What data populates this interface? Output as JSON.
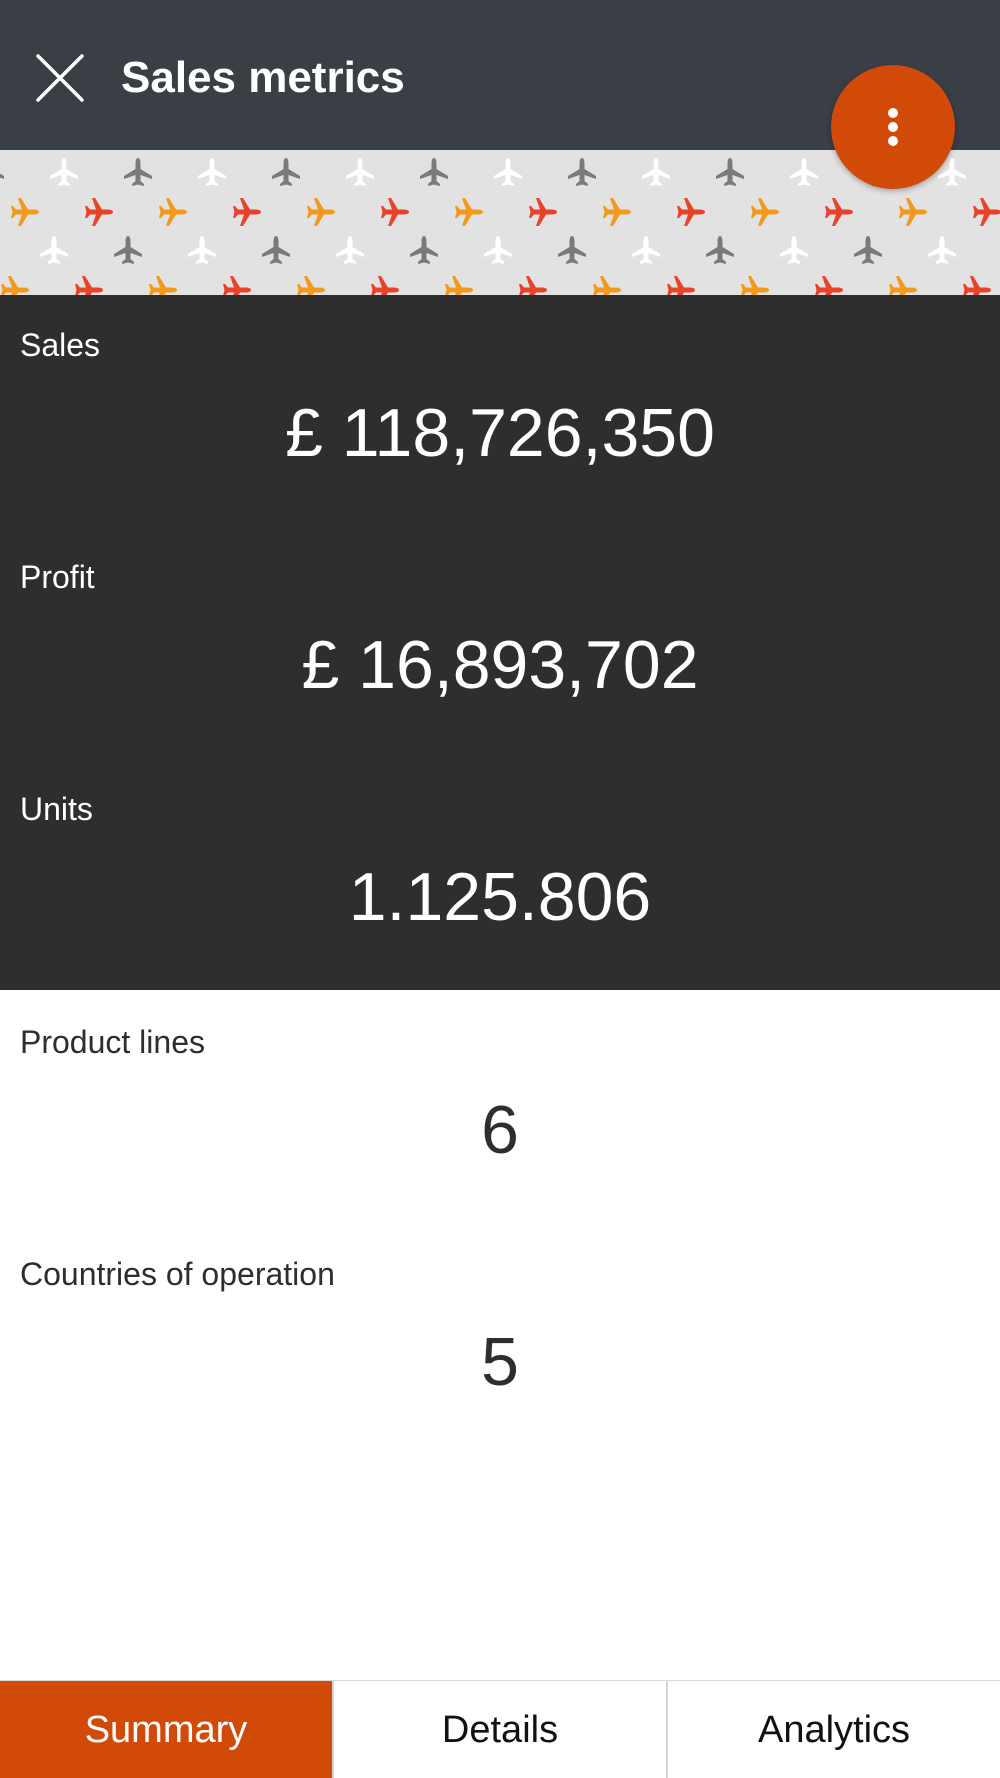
{
  "header": {
    "title": "Sales metrics",
    "close_icon": "close-icon",
    "menu_icon": "more-vertical-icon",
    "background": "#3a3f45"
  },
  "banner": {
    "pattern": "airplane-pattern",
    "colors": [
      "#7a7a7a",
      "#ffffff",
      "#e8432a",
      "#f39a1e"
    ]
  },
  "accent_color": "#d24a08",
  "metrics_dark": [
    {
      "label": "Sales",
      "value": "£ 118,726,350"
    },
    {
      "label": "Profit",
      "value": "£ 16,893,702"
    },
    {
      "label": "Units",
      "value": "1.125.806"
    }
  ],
  "metrics_light": [
    {
      "label": "Product lines",
      "value": "6"
    },
    {
      "label": "Countries of operation",
      "value": "5"
    }
  ],
  "tabs": [
    {
      "label": "Summary",
      "active": true
    },
    {
      "label": "Details",
      "active": false
    },
    {
      "label": "Analytics",
      "active": false
    }
  ]
}
